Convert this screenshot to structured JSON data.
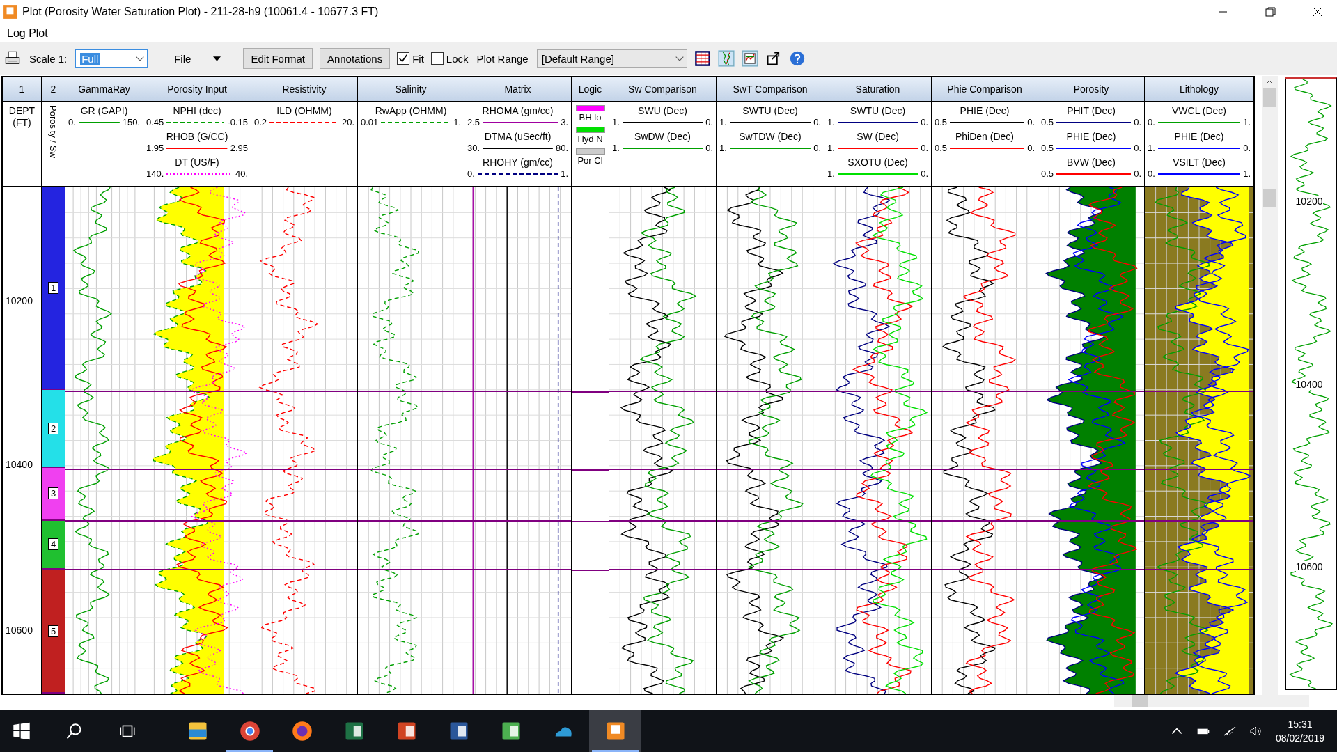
{
  "window": {
    "title": "Plot (Porosity Water Saturation Plot) - 211-28-h9 (10061.4 - 10677.3 FT)"
  },
  "menu": {
    "title": "Log Plot"
  },
  "toolbar": {
    "scale_label": "Scale 1:",
    "scale": "Full",
    "file": "File",
    "buttons": [
      "Edit Format",
      "Annotations"
    ],
    "fit": {
      "label": "Fit",
      "checked": true
    },
    "lock": {
      "label": "Lock",
      "checked": false
    },
    "range_label": "Plot Range",
    "range": "[Default Range]"
  },
  "depth_track": {
    "title": "1",
    "header": "DEPT (FT)",
    "depths": [
      "10200",
      "10400",
      "10600"
    ]
  },
  "zone_track": {
    "title": "2",
    "header": "Porosity / Sw",
    "zones": [
      {
        "label": "1",
        "color": "#2424e0"
      },
      {
        "label": "2",
        "color": "#24e0e8"
      },
      {
        "label": "3",
        "color": "#f040f0"
      },
      {
        "label": "4",
        "color": "#20c030"
      },
      {
        "label": "5",
        "color": "#c02020"
      }
    ]
  },
  "tracks": [
    {
      "kind": "log",
      "title": "GammaRay",
      "curves": [
        {
          "name": "GR (GAPI)",
          "min": "0.",
          "max": "150.",
          "color": "#00a000"
        }
      ]
    },
    {
      "kind": "log",
      "title": "Porosity Input",
      "curves": [
        {
          "name": "NPHI (dec)",
          "min": "0.45",
          "max": "-0.15",
          "color": "#00a000"
        },
        {
          "name": "RHOB (G/CC)",
          "min": "1.95",
          "max": "2.95",
          "color": "#ff0000"
        },
        {
          "name": "DT (US/F)",
          "min": "140.",
          "max": "40.",
          "color": "#ff00ff"
        }
      ]
    },
    {
      "kind": "log",
      "title": "Resistivity",
      "curves": [
        {
          "name": "ILD (OHMM)",
          "min": "0.2",
          "max": "20.",
          "color": "#ff0000"
        }
      ]
    },
    {
      "kind": "log",
      "title": "Salinity",
      "curves": [
        {
          "name": "RwApp (OHMM)",
          "min": "0.01",
          "max": "1.",
          "color": "#00a000"
        }
      ]
    },
    {
      "kind": "log",
      "title": "Matrix",
      "curves": [
        {
          "name": "RHOMA (gm/cc)",
          "min": "2.5",
          "max": "3.",
          "color": "#a000a0"
        },
        {
          "name": "DTMA (uSec/ft)",
          "min": "30.",
          "max": "80.",
          "color": "#000000"
        },
        {
          "name": "RHOHY (gm/cc)",
          "min": "0.",
          "max": "1.",
          "color": "#000080"
        }
      ]
    },
    {
      "kind": "logic",
      "title": "Logic",
      "items": [
        {
          "label": "BH lo",
          "color": "#ff00ff"
        },
        {
          "label": "Hyd N",
          "color": "#00e000"
        },
        {
          "label": "Por Cl",
          "color": "#cccccc"
        }
      ]
    },
    {
      "kind": "log",
      "title": "Sw Comparison",
      "curves": [
        {
          "name": "SWU (Dec)",
          "min": "1.",
          "max": "0.",
          "color": "#000000"
        },
        {
          "name": "SwDW (Dec)",
          "min": "1.",
          "max": "0.",
          "color": "#00a000"
        }
      ]
    },
    {
      "kind": "log",
      "title": "SwT Comparison",
      "curves": [
        {
          "name": "SWTU (Dec)",
          "min": "1.",
          "max": "0.",
          "color": "#000000"
        },
        {
          "name": "SwTDW (Dec)",
          "min": "1.",
          "max": "0.",
          "color": "#00a000"
        }
      ]
    },
    {
      "kind": "log",
      "title": "Saturation",
      "curves": [
        {
          "name": "SWTU (Dec)",
          "min": "1.",
          "max": "0.",
          "color": "#000080"
        },
        {
          "name": "SW (Dec)",
          "min": "1.",
          "max": "0.",
          "color": "#ff0000"
        },
        {
          "name": "SXOTU (Dec)",
          "min": "1.",
          "max": "0.",
          "color": "#00e000"
        }
      ]
    },
    {
      "kind": "log",
      "title": "Phie Comparison",
      "curves": [
        {
          "name": "PHIE (Dec)",
          "min": "0.5",
          "max": "0.",
          "color": "#000000"
        },
        {
          "name": "PhiDen (Dec)",
          "min": "0.5",
          "max": "0.",
          "color": "#ff0000"
        }
      ]
    },
    {
      "kind": "log",
      "title": "Porosity",
      "curves": [
        {
          "name": "PHIT (Dec)",
          "min": "0.5",
          "max": "0.",
          "color": "#000080"
        },
        {
          "name": "PHIE (Dec)",
          "min": "0.5",
          "max": "0.",
          "color": "#0000ff"
        },
        {
          "name": "BVW (Dec)",
          "min": "0.5",
          "max": "0.",
          "color": "#ff0000"
        }
      ]
    },
    {
      "kind": "log",
      "title": "Lithology",
      "curves": [
        {
          "name": "VWCL (Dec)",
          "min": "0.",
          "max": "1.",
          "color": "#00a000"
        },
        {
          "name": "PHIE (Dec)",
          "min": "1.",
          "max": "0.",
          "color": "#0000ff"
        },
        {
          "name": "VSILT (Dec)",
          "min": "0.",
          "max": "1.",
          "color": "#0000ff"
        }
      ]
    }
  ],
  "overview": {
    "depths": [
      "10200",
      "10400",
      "10600"
    ]
  },
  "taskbar": {
    "apps": [
      {
        "kind": "explorer",
        "selected": false
      },
      {
        "kind": "chrome",
        "selected": false
      },
      {
        "kind": "firefox",
        "selected": false
      },
      {
        "kind": "excel",
        "selected": false
      },
      {
        "kind": "powerpoint",
        "selected": false
      },
      {
        "kind": "word",
        "selected": false
      },
      {
        "kind": "sheet",
        "selected": false
      },
      {
        "kind": "cloud",
        "selected": false
      },
      {
        "kind": "plot",
        "selected": true
      }
    ],
    "time": "15:31",
    "date": "08/02/2019"
  }
}
